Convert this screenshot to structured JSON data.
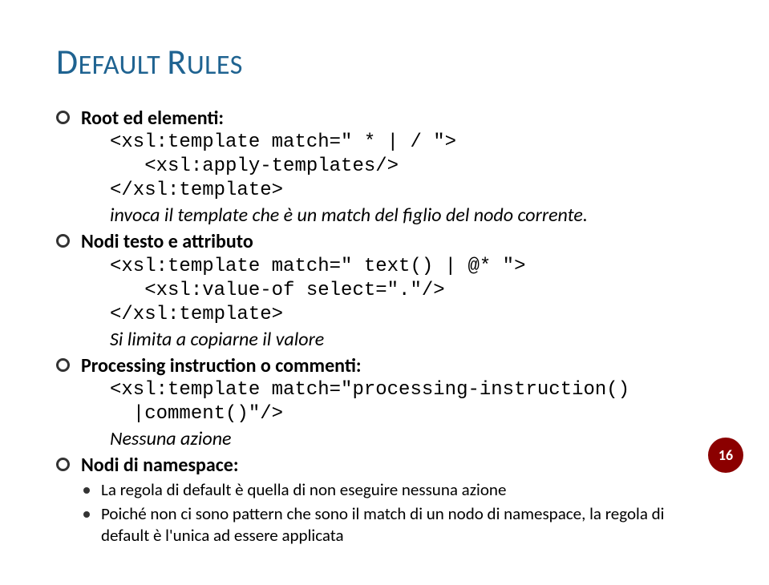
{
  "title_cap1": "D",
  "title_rest1": "EFAULT ",
  "title_cap2": "R",
  "title_rest2": "ULES",
  "items": [
    {
      "label": "Root ed elementi:",
      "code": [
        "<xsl:template match=\" * | / \">",
        "   <xsl:apply-templates/>",
        "</xsl:template>"
      ],
      "note": "invoca il template che è un match del figlio del nodo corrente."
    },
    {
      "label": "Nodi testo e attributo",
      "code": [
        "<xsl:template match=\" text() | @* \">",
        "   <xsl:value-of select=\".\"/>",
        "</xsl:template>"
      ],
      "note": "Si limita a copiarne il valore"
    },
    {
      "label": "Processing instruction o commenti:",
      "code": [
        "<xsl:template match=\"processing-instruction()",
        "  |comment()\"/>"
      ],
      "note": "Nessuna azione"
    },
    {
      "label": "Nodi di namespace:",
      "sub": [
        "La regola di default è quella di non eseguire nessuna azione",
        "Poiché non ci sono pattern che sono il match di un nodo di namespace, la regola di default è l'unica ad essere applicata"
      ]
    }
  ],
  "pagenum": "16"
}
